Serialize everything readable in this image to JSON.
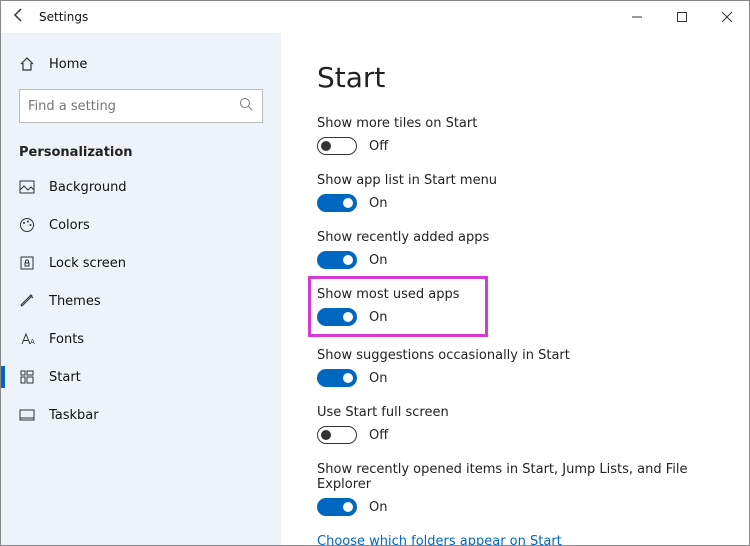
{
  "window": {
    "title": "Settings"
  },
  "sidebar": {
    "home": "Home",
    "search_placeholder": "Find a setting",
    "section": "Personalization",
    "items": [
      {
        "label": "Background"
      },
      {
        "label": "Colors"
      },
      {
        "label": "Lock screen"
      },
      {
        "label": "Themes"
      },
      {
        "label": "Fonts"
      },
      {
        "label": "Start"
      },
      {
        "label": "Taskbar"
      }
    ]
  },
  "page": {
    "heading": "Start",
    "settings": [
      {
        "label": "Show more tiles on Start",
        "on": false,
        "state": "Off"
      },
      {
        "label": "Show app list in Start menu",
        "on": true,
        "state": "On"
      },
      {
        "label": "Show recently added apps",
        "on": true,
        "state": "On"
      },
      {
        "label": "Show most used apps",
        "on": true,
        "state": "On",
        "highlighted": true
      },
      {
        "label": "Show suggestions occasionally in Start",
        "on": true,
        "state": "On"
      },
      {
        "label": "Use Start full screen",
        "on": false,
        "state": "Off"
      },
      {
        "label": "Show recently opened items in Start, Jump Lists, and File Explorer",
        "on": true,
        "state": "On"
      }
    ],
    "link": "Choose which folders appear on Start"
  }
}
